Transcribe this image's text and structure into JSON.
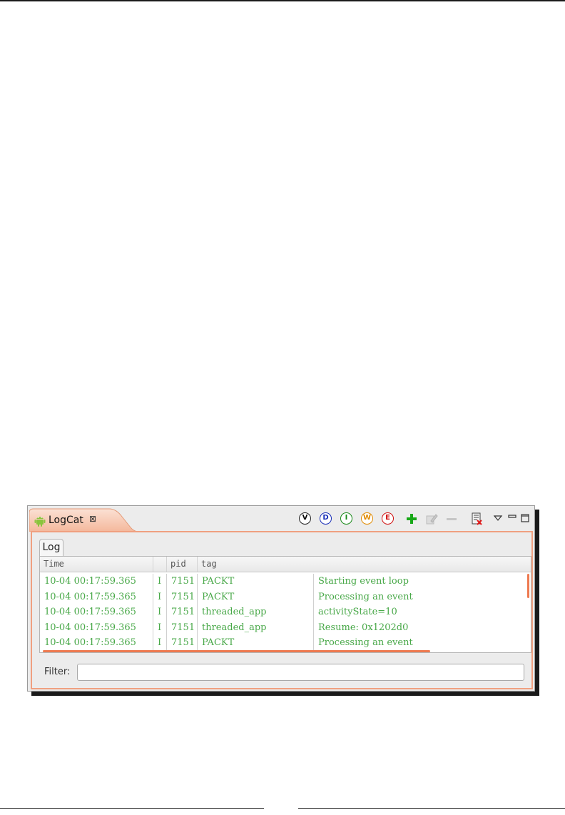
{
  "view": {
    "title": "LogCat",
    "close_glyph": "⊠",
    "icon": "android-icon"
  },
  "toolbar": {
    "levels": [
      {
        "label": "V",
        "name": "verbose",
        "color": "#222222"
      },
      {
        "label": "D",
        "name": "debug",
        "color": "#1a2fb8"
      },
      {
        "label": "I",
        "name": "info",
        "color": "#1a8a1a"
      },
      {
        "label": "W",
        "name": "warn",
        "color": "#e08a00"
      },
      {
        "label": "E",
        "name": "error",
        "color": "#d01010"
      }
    ],
    "icons": [
      "add-filter-icon",
      "edit-filter-icon",
      "remove-filter-icon",
      "clear-log-icon",
      "view-menu-icon",
      "minimize-icon",
      "maximize-icon"
    ]
  },
  "log_tab": {
    "label": "Log"
  },
  "table": {
    "columns": [
      "Time",
      "",
      "pid",
      "tag",
      ""
    ],
    "rows": [
      {
        "time": "10-04 00:17:59.365",
        "level": "I",
        "pid": "7151",
        "tag": "PACKT",
        "message": "Starting event loop"
      },
      {
        "time": "10-04 00:17:59.365",
        "level": "I",
        "pid": "7151",
        "tag": "PACKT",
        "message": "Processing an event"
      },
      {
        "time": "10-04 00:17:59.365",
        "level": "I",
        "pid": "7151",
        "tag": "threaded_app",
        "message": "activityState=10"
      },
      {
        "time": "10-04 00:17:59.365",
        "level": "I",
        "pid": "7151",
        "tag": "threaded_app",
        "message": "Resume: 0x1202d0"
      },
      {
        "time": "10-04 00:17:59.365",
        "level": "I",
        "pid": "7151",
        "tag": "PACKT",
        "message": "Processing an event"
      }
    ],
    "row_color": "#48a848"
  },
  "filter": {
    "label": "Filter:",
    "value": "",
    "placeholder": ""
  },
  "accent_color": "#ee7a50"
}
